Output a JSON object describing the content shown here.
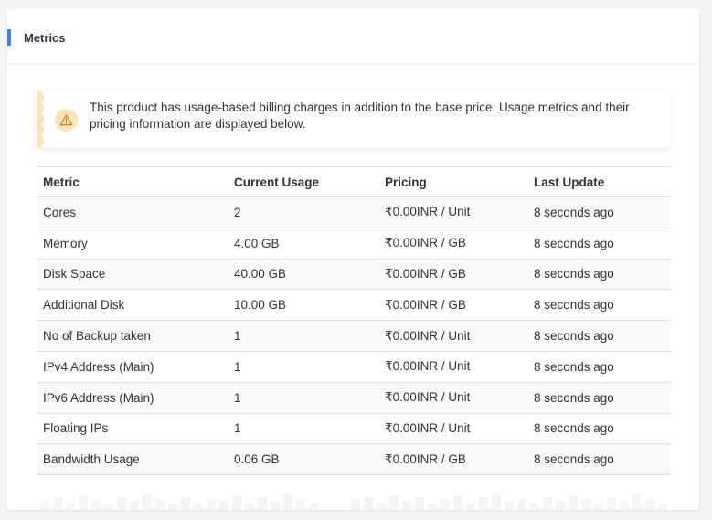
{
  "panel": {
    "title": "Metrics",
    "accent_color": "#3b82f6"
  },
  "notice": {
    "icon": "warning-icon",
    "text": "This product has usage-based billing charges in addition to the base price. Usage metrics and their pricing information are displayed below.",
    "accent_color": "#fde3bb"
  },
  "table": {
    "headers": {
      "metric": "Metric",
      "usage": "Current Usage",
      "pricing": "Pricing",
      "last_update": "Last Update"
    },
    "rows": [
      {
        "metric": "Cores",
        "usage": "2",
        "pricing": "₹0.00INR / Unit",
        "last_update": "8 seconds ago"
      },
      {
        "metric": "Memory",
        "usage": "4.00 GB",
        "pricing": "₹0.00INR / GB",
        "last_update": "8 seconds ago"
      },
      {
        "metric": "Disk Space",
        "usage": "40.00 GB",
        "pricing": "₹0.00INR / GB",
        "last_update": "8 seconds ago"
      },
      {
        "metric": "Additional Disk",
        "usage": "10.00 GB",
        "pricing": "₹0.00INR / GB",
        "last_update": "8 seconds ago"
      },
      {
        "metric": "No of Backup taken",
        "usage": "1",
        "pricing": "₹0.00INR / Unit",
        "last_update": "8 seconds ago"
      },
      {
        "metric": "IPv4 Address (Main)",
        "usage": "1",
        "pricing": "₹0.00INR / Unit",
        "last_update": "8 seconds ago"
      },
      {
        "metric": "IPv6 Address (Main)",
        "usage": "1",
        "pricing": "₹0.00INR / Unit",
        "last_update": "8 seconds ago"
      },
      {
        "metric": "Floating IPs",
        "usage": "1",
        "pricing": "₹0.00INR / Unit",
        "last_update": "8 seconds ago"
      },
      {
        "metric": "Bandwidth Usage",
        "usage": "0.06 GB",
        "pricing": "₹0.00INR / GB",
        "last_update": "8 seconds ago"
      }
    ]
  }
}
